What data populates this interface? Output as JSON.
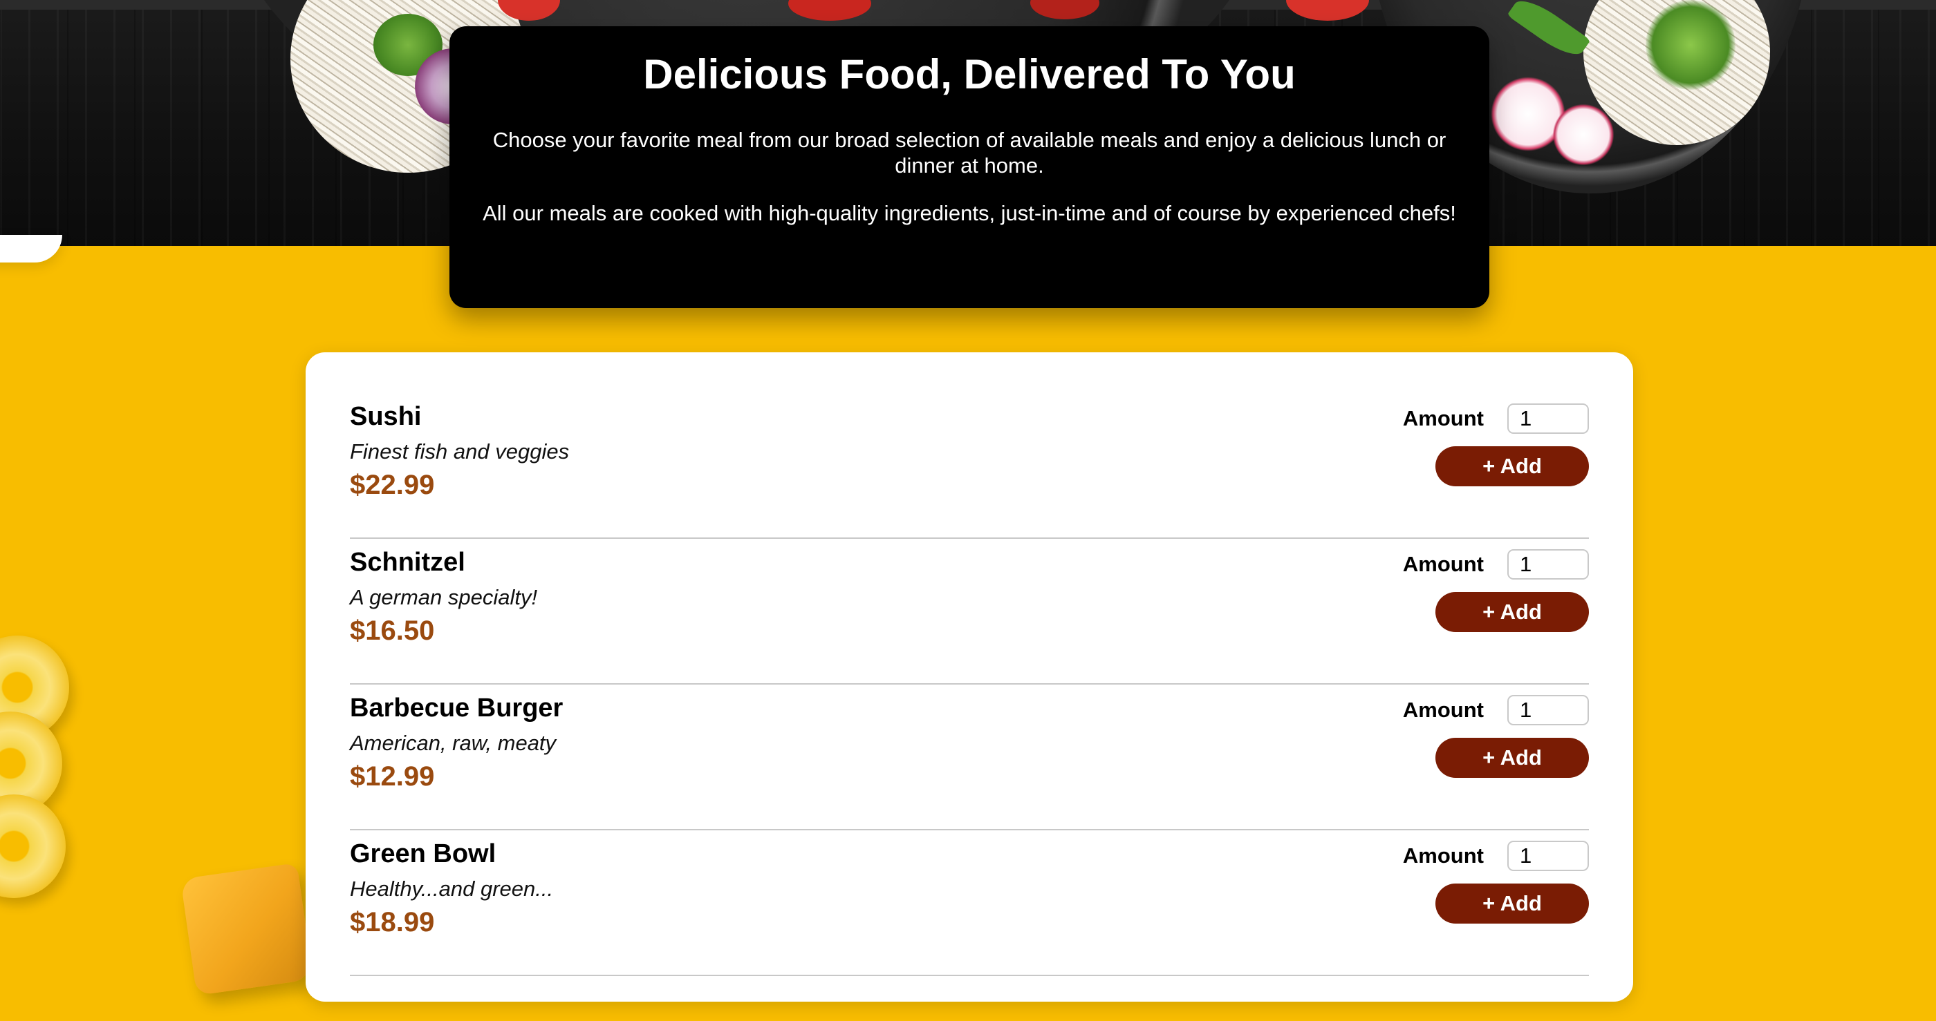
{
  "summary": {
    "title": "Delicious Food, Delivered To You",
    "paragraph_1": "Choose your favorite meal from our broad selection of available meals and enjoy a delicious lunch or dinner at home.",
    "paragraph_2": "All our meals are cooked with high-quality ingredients, just-in-time and of course by experienced chefs!"
  },
  "meals": [
    {
      "name": "Sushi",
      "description": "Finest fish and veggies",
      "price": "$22.99",
      "amount_label": "Amount",
      "amount_value": "1",
      "add_label": "+ Add"
    },
    {
      "name": "Schnitzel",
      "description": "A german specialty!",
      "price": "$16.50",
      "amount_label": "Amount",
      "amount_value": "1",
      "add_label": "+ Add"
    },
    {
      "name": "Barbecue Burger",
      "description": "American, raw, meaty",
      "price": "$12.99",
      "amount_label": "Amount",
      "amount_value": "1",
      "add_label": "+ Add"
    },
    {
      "name": "Green Bowl",
      "description": "Healthy...and green...",
      "price": "$18.99",
      "amount_label": "Amount",
      "amount_value": "1",
      "add_label": "+ Add"
    }
  ],
  "colors": {
    "page_background": "#f8bd00",
    "summary_background": "#000000",
    "price": "#9a4a0f",
    "add_button": "#7a1c04"
  }
}
